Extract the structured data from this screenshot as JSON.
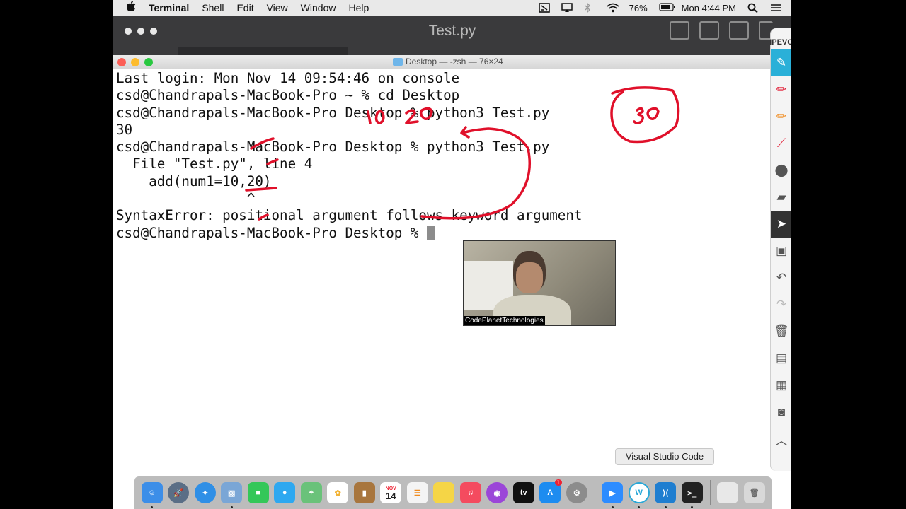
{
  "menubar": {
    "apple": "",
    "items": [
      "Terminal",
      "Shell",
      "Edit",
      "View",
      "Window",
      "Help"
    ],
    "battery": "76%",
    "clock": "Mon 4:44 PM"
  },
  "editor": {
    "title": "Test.py"
  },
  "terminal": {
    "title": "Desktop — -zsh — 76×24",
    "lines": [
      "Last login: Mon Nov 14 09:54:46 on console",
      "csd@Chandrapals-MacBook-Pro ~ % cd Desktop",
      "csd@Chandrapals-MacBook-Pro Desktop % python3 Test.py",
      "30",
      "csd@Chandrapals-MacBook-Pro Desktop % python3 Test.py",
      "  File \"Test.py\", line 4",
      "    add(num1=10,20)",
      "                ^",
      "SyntaxError: positional argument follows keyword argument",
      "csd@Chandrapals-MacBook-Pro Desktop % "
    ]
  },
  "webcam": {
    "label": "CodePlanetTechnologies"
  },
  "toolbar": {
    "logo": "IPEVO"
  },
  "tooltip": {
    "text": "Visual Studio Code"
  },
  "dock": {
    "calendar_month": "NOV",
    "calendar_day": "14",
    "appstore_badge": "1",
    "items": [
      {
        "name": "finder",
        "color": "#3c8ee8"
      },
      {
        "name": "launchpad",
        "color": "#5a6e86"
      },
      {
        "name": "safari",
        "color": "#2f8fe6"
      },
      {
        "name": "preview",
        "color": "#7aa6d6"
      },
      {
        "name": "facetime",
        "color": "#34c759"
      },
      {
        "name": "messages",
        "color": "#2ea8f0"
      },
      {
        "name": "maps",
        "color": "#6ac27a"
      },
      {
        "name": "photos",
        "color": "#f2b233"
      },
      {
        "name": "notes-brown",
        "color": "#a8763e"
      },
      {
        "name": "calendar",
        "color": "#ffffff"
      },
      {
        "name": "reminders",
        "color": "#f4f4f4"
      },
      {
        "name": "notes",
        "color": "#f5d546"
      },
      {
        "name": "music",
        "color": "#f44b5f"
      },
      {
        "name": "podcasts",
        "color": "#9b46d8"
      },
      {
        "name": "tv",
        "color": "#111111"
      },
      {
        "name": "app-store",
        "color": "#1d8cf0"
      },
      {
        "name": "system-preferences",
        "color": "#8c8c8c"
      },
      {
        "name": "zoom",
        "color": "#2d8cff"
      },
      {
        "name": "whiteboard",
        "color": "#2aa8d8"
      },
      {
        "name": "vscode",
        "color": "#1f7ed0"
      },
      {
        "name": "terminal",
        "color": "#222222"
      },
      {
        "name": "documents",
        "color": "#e8e8e8"
      },
      {
        "name": "trash",
        "color": "#d8d8d8"
      }
    ]
  }
}
